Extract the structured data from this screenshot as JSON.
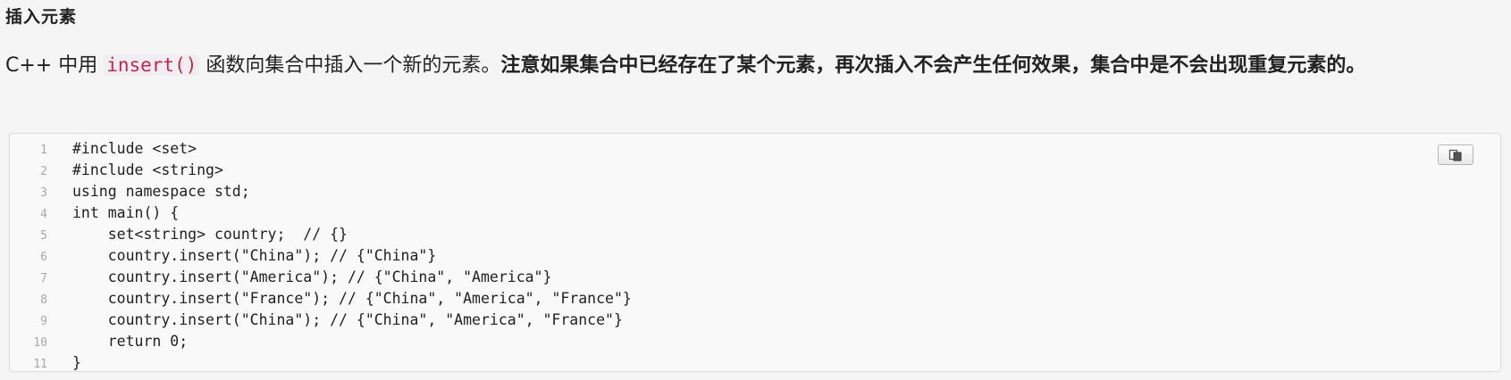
{
  "section_title": "插入元素",
  "paragraph": {
    "part1": "C++ 中用 ",
    "inline_code": "insert()",
    "part2": " 函数向集合中插入一个新的元素。",
    "part3_bold": "注意如果集合中已经存在了某个元素，再次插入不会产生任何效果，集合中是不会出现重复元素的。"
  },
  "code": {
    "copy_icon": "copy-icon",
    "lines": [
      {
        "n": "1",
        "text": "#include <set>"
      },
      {
        "n": "2",
        "text": "#include <string>"
      },
      {
        "n": "3",
        "text": "using namespace std;"
      },
      {
        "n": "4",
        "text": "int main() {"
      },
      {
        "n": "5",
        "text": "    set<string> country;  // {}"
      },
      {
        "n": "6",
        "text": "    country.insert(\"China\"); // {\"China\"}"
      },
      {
        "n": "7",
        "text": "    country.insert(\"America\"); // {\"China\", \"America\"}"
      },
      {
        "n": "8",
        "text": "    country.insert(\"France\"); // {\"China\", \"America\", \"France\"}"
      },
      {
        "n": "9",
        "text": "    country.insert(\"China\"); // {\"China\", \"America\", \"France\"}"
      },
      {
        "n": "10",
        "text": "    return 0;"
      },
      {
        "n": "11",
        "text": "}"
      }
    ]
  }
}
